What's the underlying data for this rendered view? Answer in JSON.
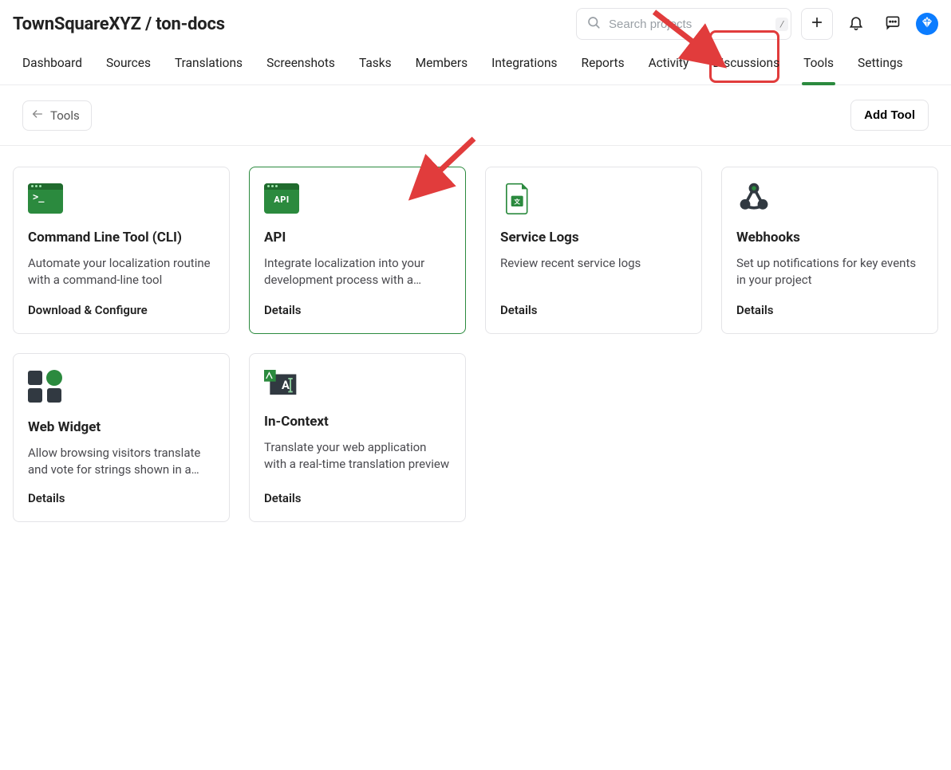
{
  "breadcrumb": "TownSquareXYZ / ton-docs",
  "search": {
    "placeholder": "Search projects",
    "shortcut": "/"
  },
  "nav": {
    "items": [
      "Dashboard",
      "Sources",
      "Translations",
      "Screenshots",
      "Tasks",
      "Members",
      "Integrations",
      "Reports",
      "Activity",
      "Discussions",
      "Tools",
      "Settings"
    ],
    "active_index": 10
  },
  "subhead": {
    "back_label": "Tools",
    "add_label": "Add Tool"
  },
  "cards": [
    {
      "icon": "terminal-icon",
      "title": "Command Line Tool (CLI)",
      "desc": "Automate your localization routine with a command-line tool",
      "action": "Download & Configure"
    },
    {
      "icon": "api-icon",
      "title": "API",
      "desc": "Integrate localization into your development process with a…",
      "action": "Details",
      "highlight": true
    },
    {
      "icon": "service-logs-icon",
      "title": "Service Logs",
      "desc": "Review recent service logs",
      "action": "Details"
    },
    {
      "icon": "webhook-icon",
      "title": "Webhooks",
      "desc": "Set up notifications for key events in your project",
      "action": "Details"
    },
    {
      "icon": "web-widget-icon",
      "title": "Web Widget",
      "desc": "Allow browsing visitors translate and vote for strings shown in a…",
      "action": "Details"
    },
    {
      "icon": "in-context-icon",
      "title": "In-Context",
      "desc": "Translate your web application with a real-time translation preview",
      "action": "Details"
    }
  ],
  "annotation": {
    "highlight_tab_index": 10
  }
}
